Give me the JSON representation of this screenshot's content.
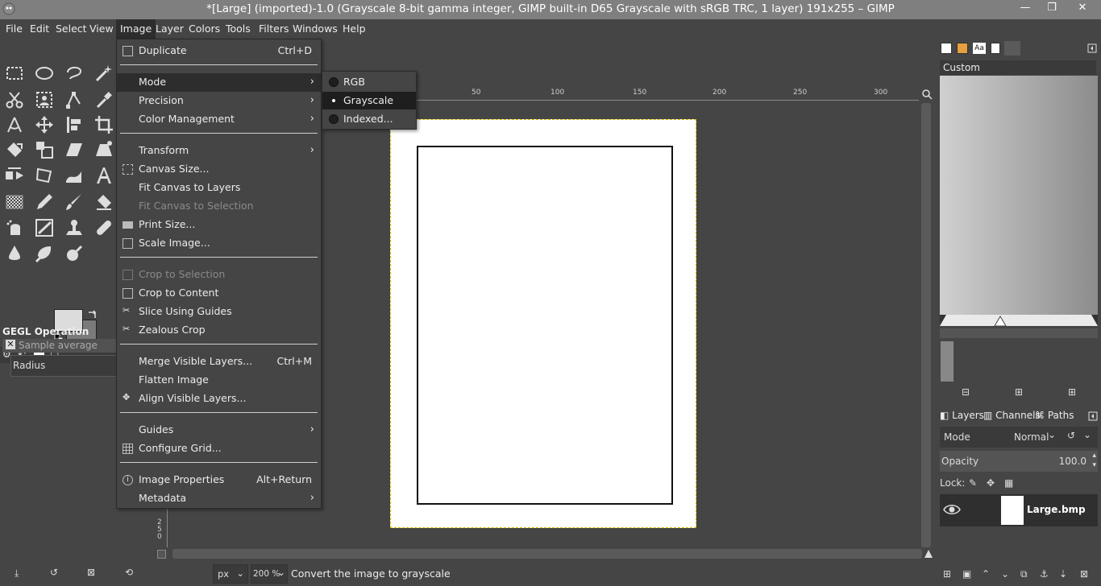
{
  "window": {
    "title": "*[Large] (imported)-1.0 (Grayscale 8-bit gamma integer, GIMP built-in D65 Grayscale with sRGB TRC, 1 layer) 191x255 – GIMP",
    "minimize": "—",
    "maximize": "❐",
    "close": "✕"
  },
  "menubar": [
    "File",
    "Edit",
    "Select",
    "View",
    "Image",
    "Layer",
    "Colors",
    "Tools",
    "Filters",
    "Windows",
    "Help"
  ],
  "image_menu": {
    "duplicate": "Duplicate",
    "duplicate_accel": "Ctrl+D",
    "mode": "Mode",
    "precision": "Precision",
    "color_management": "Color Management",
    "transform": "Transform",
    "canvas_size": "Canvas Size...",
    "fit_canvas_layers": "Fit Canvas to Layers",
    "fit_canvas_selection": "Fit Canvas to Selection",
    "print_size": "Print Size...",
    "scale_image": "Scale Image...",
    "crop_selection": "Crop to Selection",
    "crop_content": "Crop to Content",
    "slice_guides": "Slice Using Guides",
    "zealous_crop": "Zealous Crop",
    "merge_visible": "Merge Visible Layers...",
    "merge_visible_accel": "Ctrl+M",
    "flatten": "Flatten Image",
    "align_visible": "Align Visible Layers...",
    "guides": "Guides",
    "configure_grid": "Configure Grid...",
    "image_properties": "Image Properties",
    "image_properties_accel": "Alt+Return",
    "metadata": "Metadata"
  },
  "mode_submenu": {
    "rgb": "RGB",
    "grayscale": "Grayscale",
    "indexed": "Indexed...",
    "selected": "grayscale"
  },
  "tool_options": {
    "title": "GEGL Operation",
    "sample": "Sample average",
    "radius_label": "Radius"
  },
  "ruler": {
    "h_ticks": [
      "50",
      "100",
      "150",
      "200",
      "250",
      "300"
    ],
    "v_label": "250"
  },
  "status": {
    "unit": "px",
    "zoom": "200 %",
    "message": "Convert the image to grayscale"
  },
  "gradients": {
    "name": "Custom"
  },
  "layers_dock": {
    "tabs": [
      "Layers",
      "Channels",
      "Paths"
    ],
    "mode_label": "Mode",
    "mode_value": "Normal",
    "opacity_label": "Opacity",
    "opacity_value": "100.0",
    "lock_label": "Lock:",
    "layer_name": "Large.bmp"
  },
  "colors": {
    "fg": "#dcdcdc",
    "bg": "#7a7a7a",
    "highlight": "#2d2d2d",
    "marching_ants": "#d9c200"
  }
}
